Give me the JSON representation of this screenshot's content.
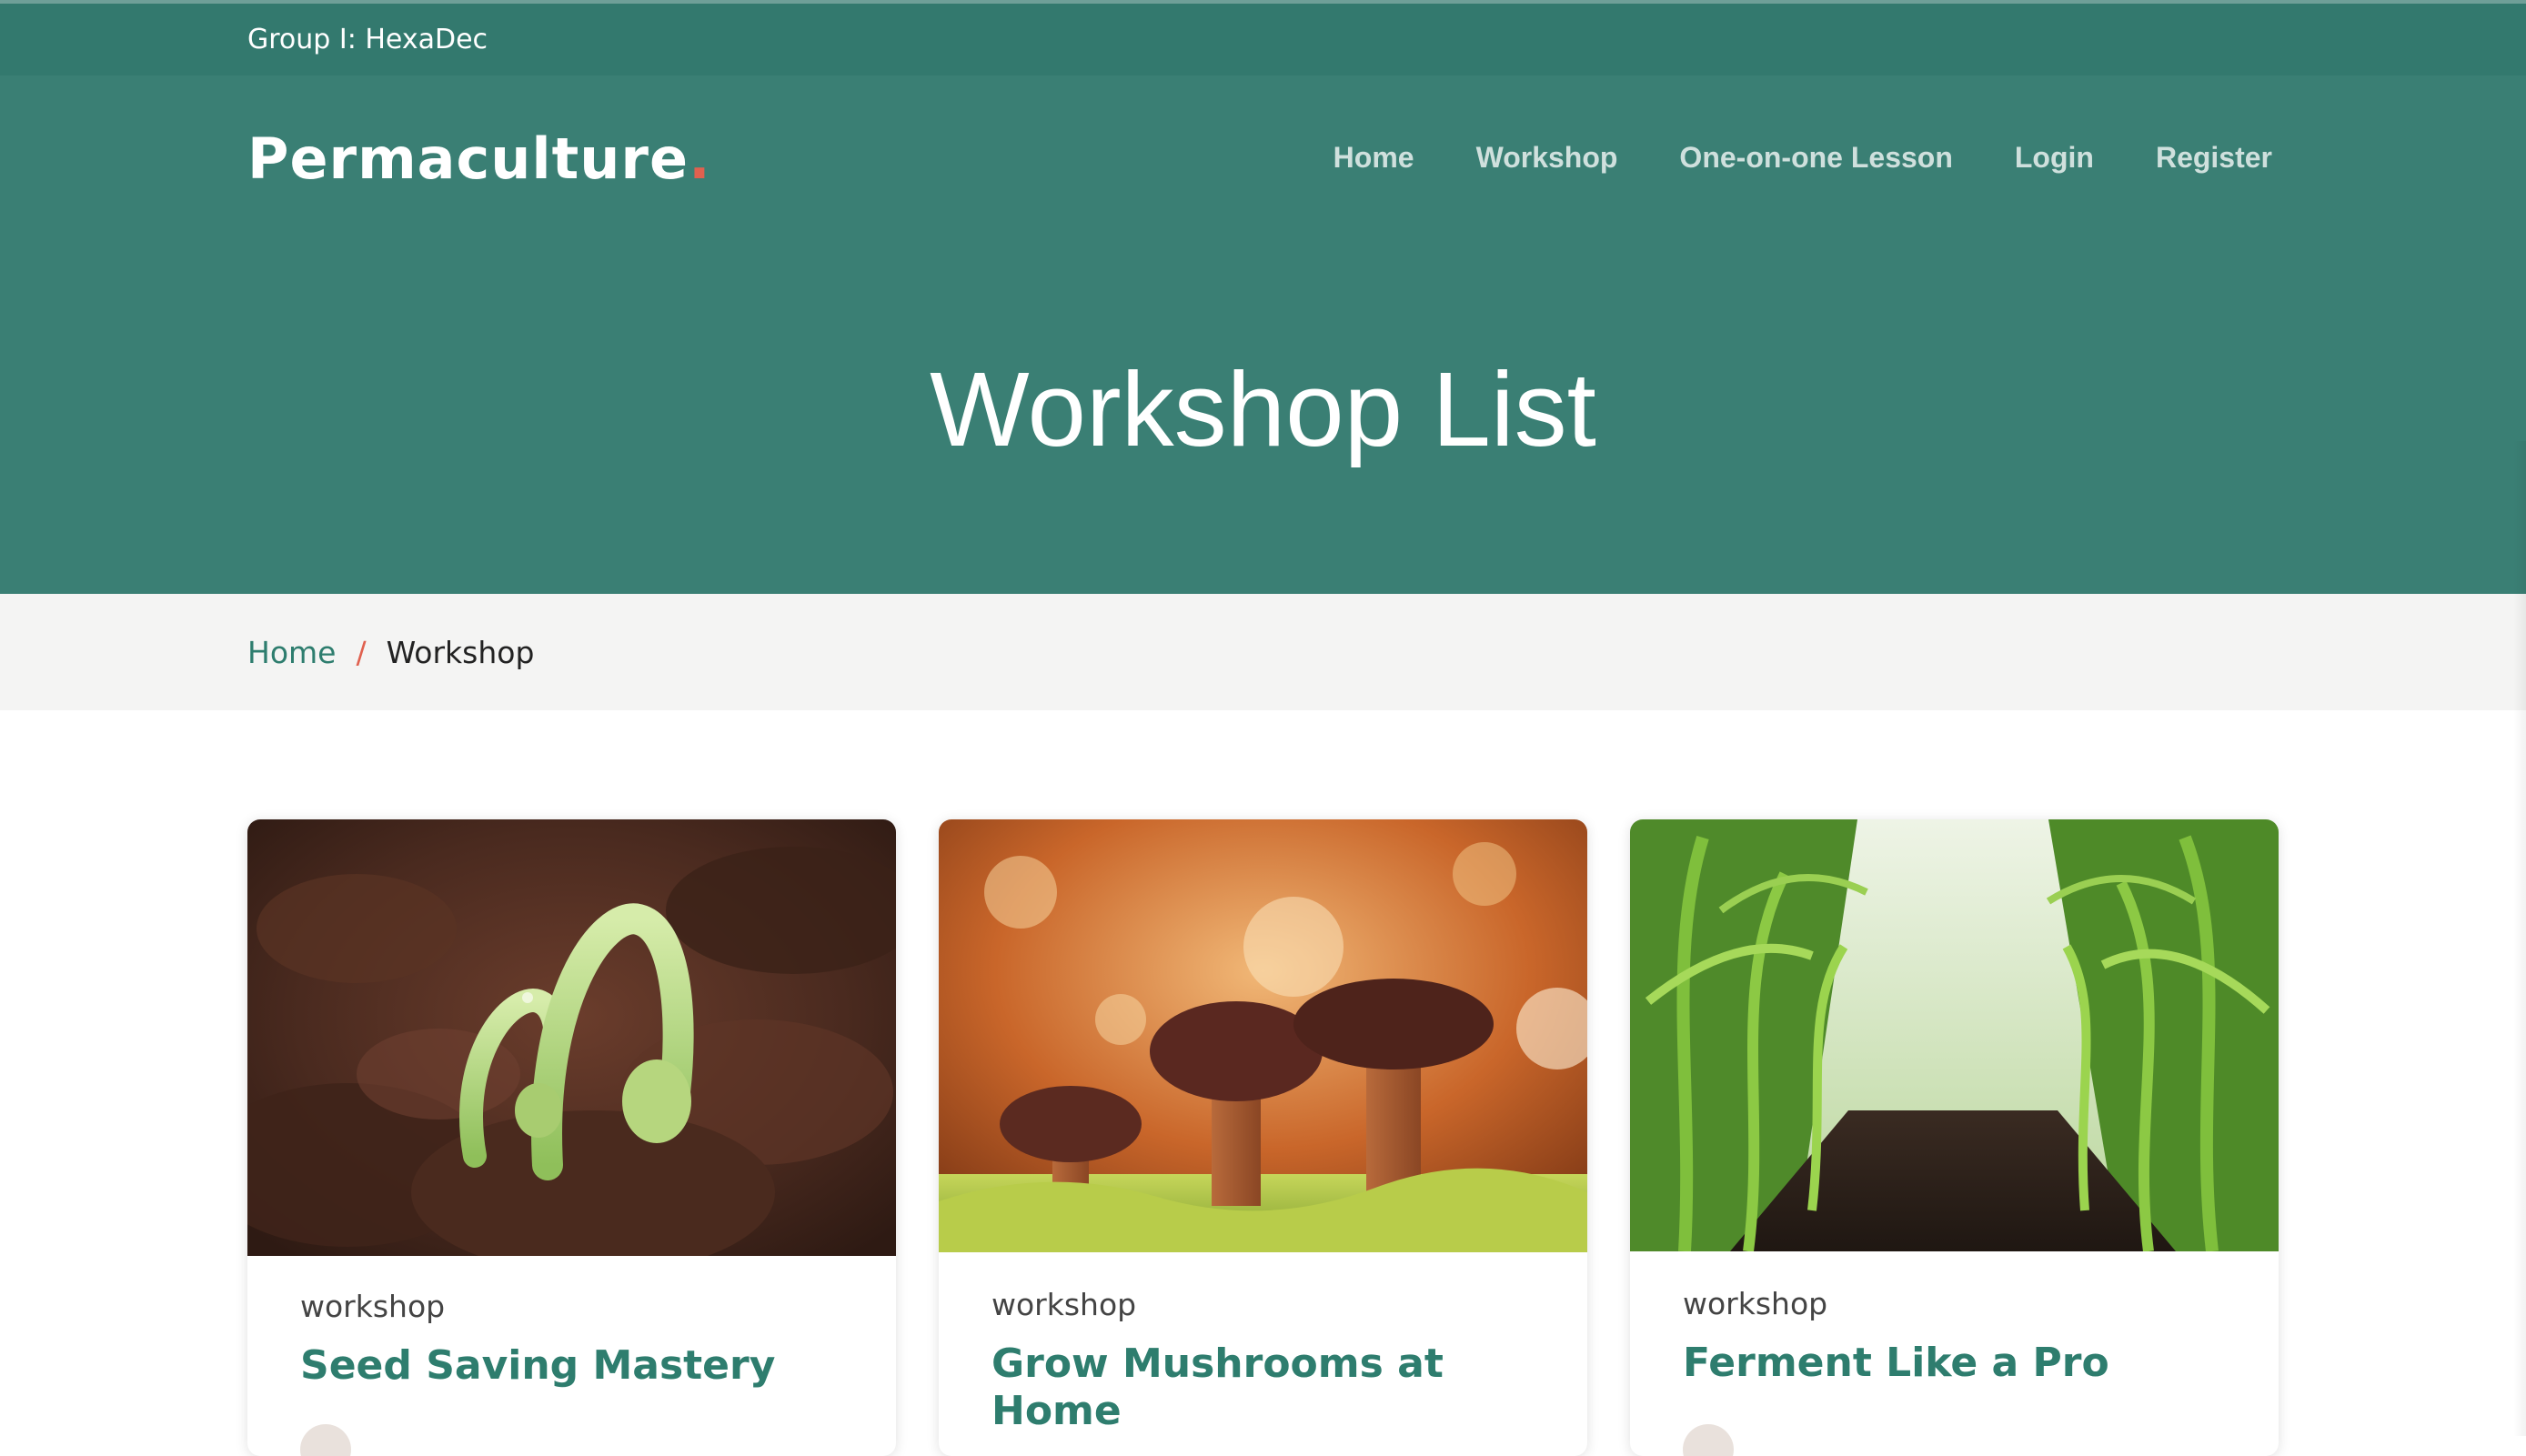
{
  "topbar": {
    "text": "Group I: HexaDec"
  },
  "header": {
    "logo_text": "Permaculture",
    "logo_dot": ".",
    "nav": [
      {
        "label": "Home"
      },
      {
        "label": "Workshop"
      },
      {
        "label": "One-on-one Lesson"
      },
      {
        "label": "Login"
      },
      {
        "label": "Register"
      }
    ]
  },
  "hero": {
    "title": "Workshop List"
  },
  "breadcrumb": {
    "home": "Home",
    "separator": "/",
    "current": "Workshop"
  },
  "cards": [
    {
      "tag": "workshop",
      "title": "Seed Saving Mastery",
      "image": "seedling-sprouts-in-soil"
    },
    {
      "tag": "workshop",
      "title": "Grow Mushrooms at Home",
      "image": "mushrooms-on-moss"
    },
    {
      "tag": "workshop",
      "title": "Ferment Like a Pro",
      "image": "corn-field-rows"
    }
  ],
  "colors": {
    "brand_green": "#3a7f74",
    "topbar_green": "#33796e",
    "accent_red": "#e0614f",
    "title_green": "#2e7d6e"
  }
}
